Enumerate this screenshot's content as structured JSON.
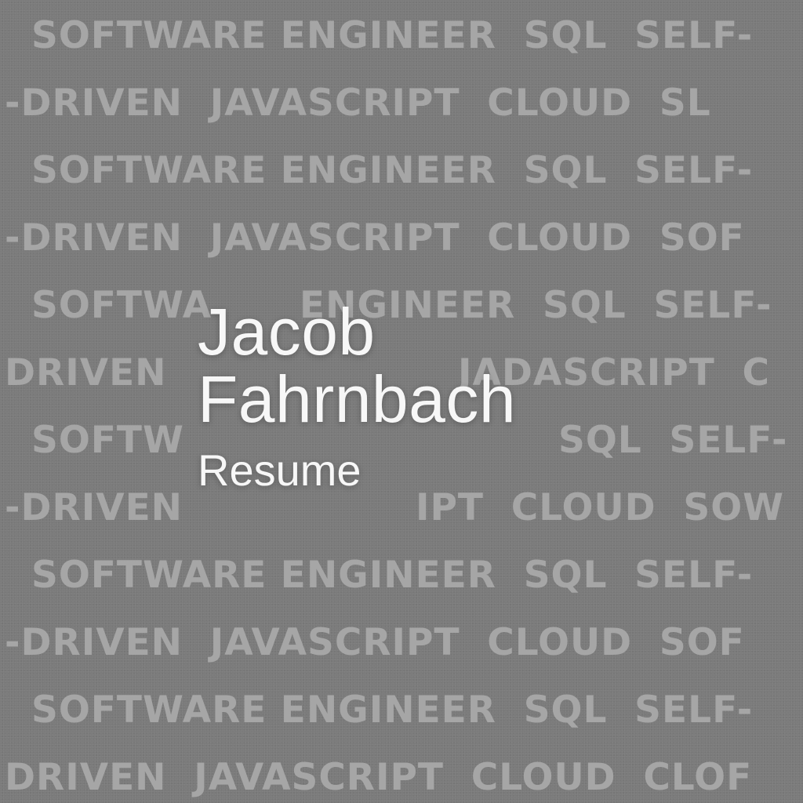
{
  "background": {
    "color": "#7b7b7b",
    "pattern_color": "#a6a6a6",
    "rows": [
      "SOFTWARE ENGINEER  SQL  SELF-",
      "-DRIVEN  JAVASCRIPT  CLOUD  SL",
      "SOFTWARE ENGINEER  SQL  SELF-",
      "-DRIVEN  JAVASCRIPT  CLOUD  SOF",
      "SOFTWA",
      "DRIVEN",
      "SOFTW",
      "-DRIVEN",
      "SOFTWARE ENGINEER  SQL  SELF-",
      "-DRIVEN  JAVASCRIPT  CLOUD  SOF",
      "SOFTWARE ENGINEER  SQL  SELF-",
      "DRIVEN  JAVASCRIPT  CLOUD  CLOF"
    ],
    "fragments": {
      "row5_right": "ENGINEER  SQL  SELF-",
      "row6_right": "JADASCRIPT  C",
      "row7_right": "SQL  SELF-",
      "row8_right": "IPT  CLOUD  SOW"
    }
  },
  "title": {
    "first_name": "Jacob",
    "last_name": "Fahrnbach",
    "subtitle": "Resume",
    "color": "#f7f7f7"
  }
}
